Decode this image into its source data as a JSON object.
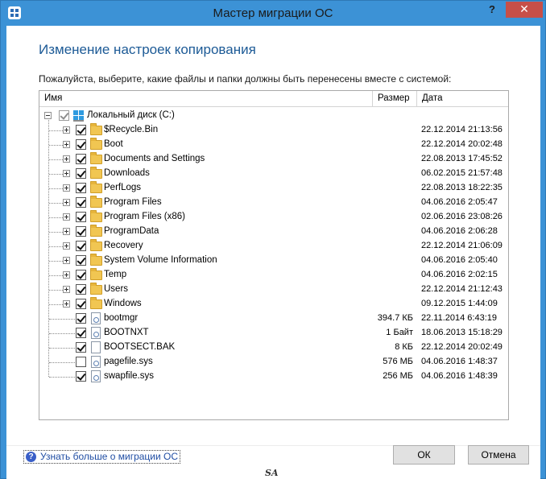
{
  "window": {
    "title": "Мастер миграции ОС",
    "help_label": "?",
    "close_label": "✕"
  },
  "page": {
    "heading": "Изменение настроек копирования",
    "instruction": "Пожалуйста, выберите, какие файлы и папки должны быть перенесены вместе с системой:"
  },
  "tree": {
    "columns": {
      "name": "Имя",
      "size": "Размер",
      "date": "Дата"
    },
    "root": {
      "label": "Локальный диск (C:)",
      "checked": true,
      "state": "partial"
    },
    "items": [
      {
        "label": "$Recycle.Bin",
        "type": "folder",
        "size": "",
        "date": "22.12.2014 21:13:56",
        "checked": true
      },
      {
        "label": "Boot",
        "type": "folder",
        "size": "",
        "date": "22.12.2014 20:02:48",
        "checked": true
      },
      {
        "label": "Documents and Settings",
        "type": "folder",
        "size": "",
        "date": "22.08.2013 17:45:52",
        "checked": true
      },
      {
        "label": "Downloads",
        "type": "folder",
        "size": "",
        "date": "06.02.2015 21:57:48",
        "checked": true
      },
      {
        "label": "PerfLogs",
        "type": "folder",
        "size": "",
        "date": "22.08.2013 18:22:35",
        "checked": true
      },
      {
        "label": "Program Files",
        "type": "folder",
        "size": "",
        "date": "04.06.2016 2:05:47",
        "checked": true
      },
      {
        "label": "Program Files (x86)",
        "type": "folder",
        "size": "",
        "date": "02.06.2016 23:08:26",
        "checked": true
      },
      {
        "label": "ProgramData",
        "type": "folder",
        "size": "",
        "date": "04.06.2016 2:06:28",
        "checked": true
      },
      {
        "label": "Recovery",
        "type": "folder",
        "size": "",
        "date": "22.12.2014 21:06:09",
        "checked": true
      },
      {
        "label": "System Volume Information",
        "type": "folder",
        "size": "",
        "date": "04.06.2016 2:05:40",
        "checked": true
      },
      {
        "label": "Temp",
        "type": "folder",
        "size": "",
        "date": "04.06.2016 2:02:15",
        "checked": true
      },
      {
        "label": "Users",
        "type": "folder",
        "size": "",
        "date": "22.12.2014 21:12:43",
        "checked": true
      },
      {
        "label": "Windows",
        "type": "folder",
        "size": "",
        "date": "09.12.2015 1:44:09",
        "checked": true
      },
      {
        "label": "bootmgr",
        "type": "sysfile",
        "size": "394.7 КБ",
        "date": "22.11.2014 6:43:19",
        "checked": true
      },
      {
        "label": "BOOTNXT",
        "type": "sysfile",
        "size": "1 Байт",
        "date": "18.06.2013 15:18:29",
        "checked": true
      },
      {
        "label": "BOOTSECT.BAK",
        "type": "file",
        "size": "8 КБ",
        "date": "22.12.2014 20:02:49",
        "checked": true
      },
      {
        "label": "pagefile.sys",
        "type": "sysfile",
        "size": "576 МБ",
        "date": "04.06.2016 1:48:37",
        "checked": false
      },
      {
        "label": "swapfile.sys",
        "type": "sysfile",
        "size": "256 МБ",
        "date": "04.06.2016 1:48:39",
        "checked": true
      }
    ]
  },
  "footer": {
    "help_link": "Узнать больше о миграции ОС",
    "ok_label": "ОК",
    "cancel_label": "Отмена",
    "watermark": "SA"
  }
}
